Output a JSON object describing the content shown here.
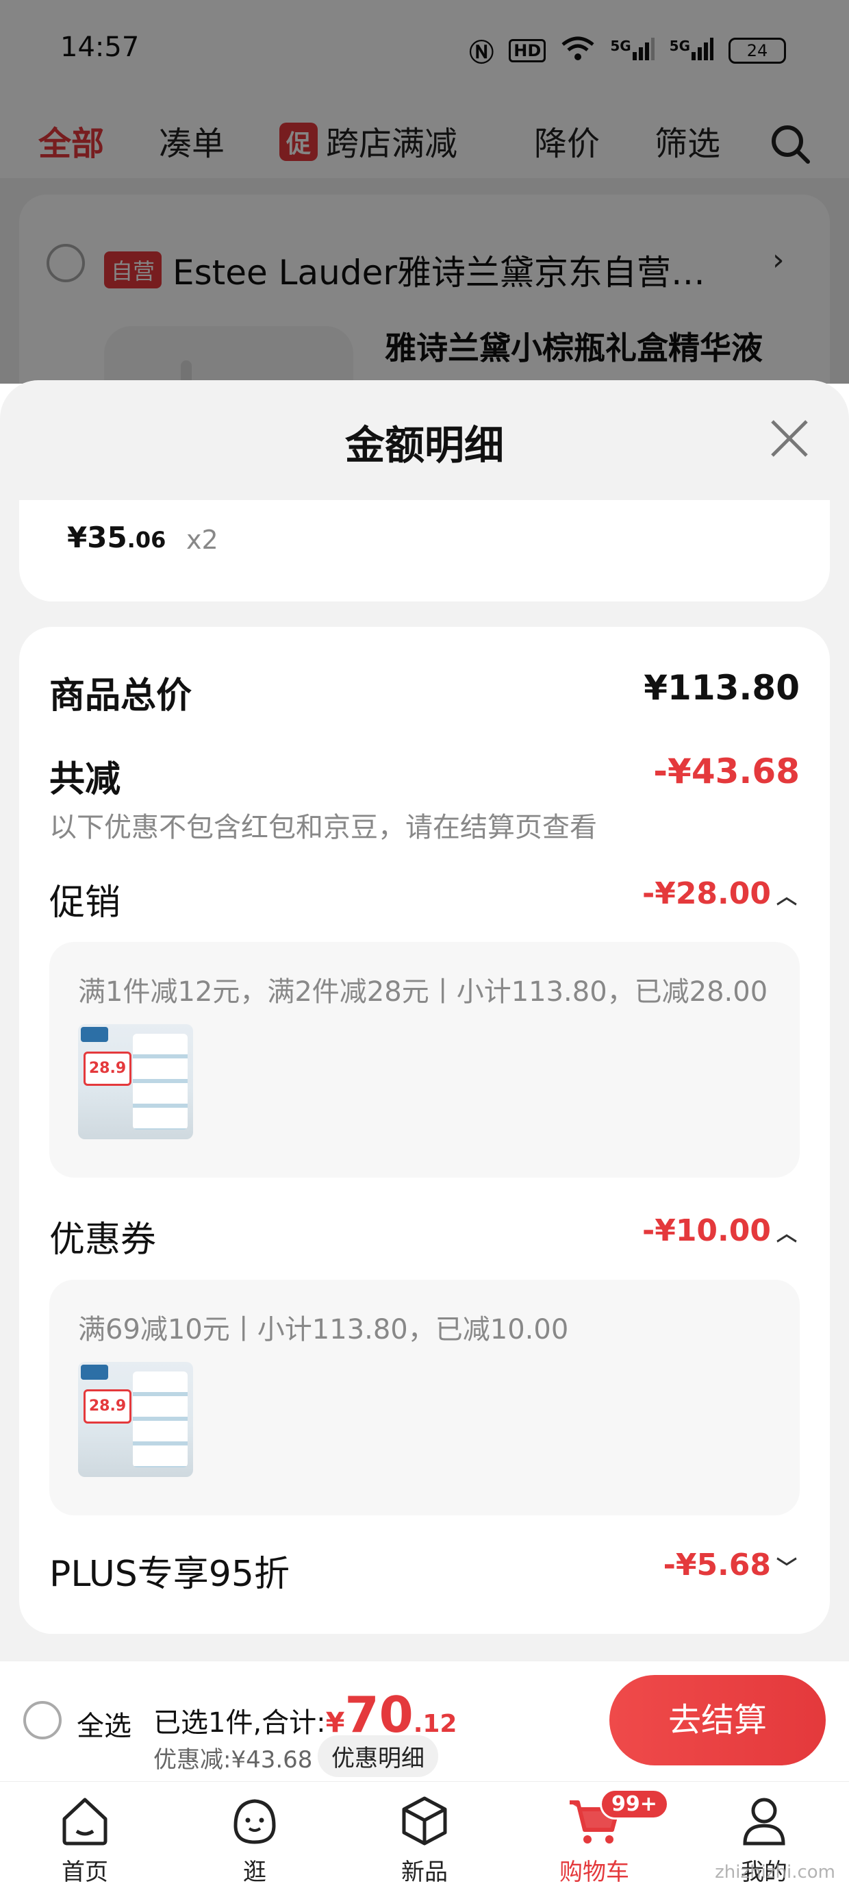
{
  "status_bar": {
    "time": "14:57",
    "net1": "HD",
    "net2": "5G",
    "net3": "5G",
    "battery": "24"
  },
  "tabs": {
    "all": "全部",
    "combine": "凑单",
    "promo_badge": "促",
    "cross_store": "跨店满减",
    "price_drop": "降价",
    "filter": "筛选"
  },
  "store": {
    "self_badge": "自营",
    "name": "Estee Lauder雅诗兰黛京东自营…",
    "product_name": "雅诗兰黛小棕瓶礼盒精华液"
  },
  "sheet": {
    "title": "金额明细",
    "item": {
      "price_int": "¥35",
      "price_dec": ".06",
      "qty": "x2"
    },
    "total_label": "商品总价",
    "total_value": "¥113.80",
    "reduce_label": "共减",
    "reduce_value": "-¥43.68",
    "reduce_note": "以下优惠不包含红包和京豆，请在结算页查看",
    "promo": {
      "label": "促销",
      "value": "-¥28.00",
      "detail": "满1件减12元，满2件减28元丨小计113.80，已减28.00"
    },
    "coupon": {
      "label": "优惠券",
      "value": "-¥10.00",
      "detail": "满69减10元丨小计113.80，已减10.00"
    },
    "plus": {
      "label": "PLUS专享95折",
      "value": "-¥5.68"
    },
    "thumb_price": "28.9"
  },
  "cart_bar": {
    "select_all": "全选",
    "summary_prefix": "已选1件,合计:",
    "currency": "¥",
    "total_int": "70",
    "total_dec": ".12",
    "discount_text": "优惠减:¥43.68",
    "detail_button": "优惠明细",
    "checkout": "去结算"
  },
  "nav": {
    "home": "首页",
    "browse": "逛",
    "new": "新品",
    "cart": "购物车",
    "cart_badge": "99+",
    "mine": "我的"
  },
  "watermark": "zhizhizhi.com",
  "colors": {
    "accent": "#e4393c"
  }
}
